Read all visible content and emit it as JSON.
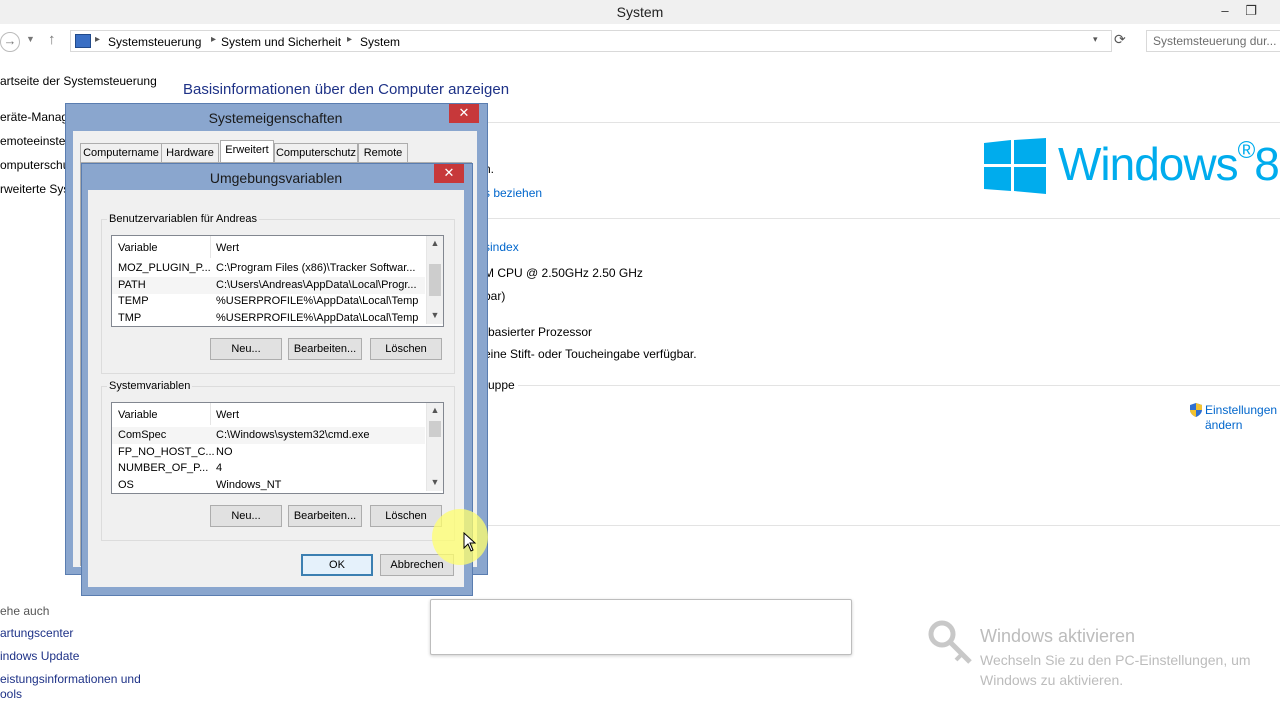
{
  "window": {
    "title": "System",
    "minimize_glyph": "–",
    "restore_glyph": "❐"
  },
  "address": {
    "crumbs": [
      "Systemsteuerung",
      "System und Sicherheit",
      "System"
    ],
    "search_placeholder": "Systemsteuerung dur..."
  },
  "left_pane": {
    "home_link": "artseite der Systemsteuerung",
    "links": [
      "eräte-Manag",
      "emoteeinstel",
      "omputerschu",
      "rweiterte Syst"
    ],
    "see_also_label": "ehe auch",
    "see_also": [
      "artungscenter",
      "indows Update",
      "eistungsinformationen und",
      "ools"
    ]
  },
  "main": {
    "heading": "Basisinformationen über den Computer anzeigen",
    "partial_lines": [
      "n.",
      "s beziehen",
      "sindex",
      "M CPU @ 2.50GHz   2.50 GHz",
      "bar)",
      "-basierter Prozessor",
      "eine Stift- oder Toucheingabe verfügbar.",
      "ruppe"
    ],
    "change_settings": [
      "Einstellungen",
      "ändern"
    ],
    "logo_text": "Windows",
    "logo_version": "8"
  },
  "activation": {
    "title": "Windows aktivieren",
    "subtitle": "Wechseln Sie zu den PC-Einstellungen, um Windows zu aktivieren."
  },
  "sysprops": {
    "title": "Systemeigenschaften",
    "tabs": [
      "Computername",
      "Hardware",
      "Erweitert",
      "Computerschutz",
      "Remote"
    ],
    "active_tab": "Erweitert"
  },
  "envvars": {
    "title": "Umgebungsvariablen",
    "user_group_label": "Benutzervariablen für Andreas",
    "system_group_label": "Systemvariablen",
    "col_variable": "Variable",
    "col_value": "Wert",
    "user_vars": [
      {
        "name": "MOZ_PLUGIN_P...",
        "value": "C:\\Program Files (x86)\\Tracker Softwar..."
      },
      {
        "name": "PATH",
        "value": "C:\\Users\\Andreas\\AppData\\Local\\Progr..."
      },
      {
        "name": "TEMP",
        "value": "%USERPROFILE%\\AppData\\Local\\Temp"
      },
      {
        "name": "TMP",
        "value": "%USERPROFILE%\\AppData\\Local\\Temp"
      }
    ],
    "system_vars": [
      {
        "name": "ComSpec",
        "value": "C:\\Windows\\system32\\cmd.exe"
      },
      {
        "name": "FP_NO_HOST_C...",
        "value": "NO"
      },
      {
        "name": "NUMBER_OF_P...",
        "value": "4"
      },
      {
        "name": "OS",
        "value": "Windows_NT"
      }
    ],
    "btn_new": "Neu...",
    "btn_edit": "Bearbeiten...",
    "btn_delete": "Löschen",
    "btn_ok": "OK",
    "btn_cancel": "Abbrechen"
  },
  "colors": {
    "accent_blue": "#1e3287",
    "logo_cyan": "#00aced",
    "close_red": "#c7383a",
    "dialog_frame": "#8aa6ce"
  }
}
